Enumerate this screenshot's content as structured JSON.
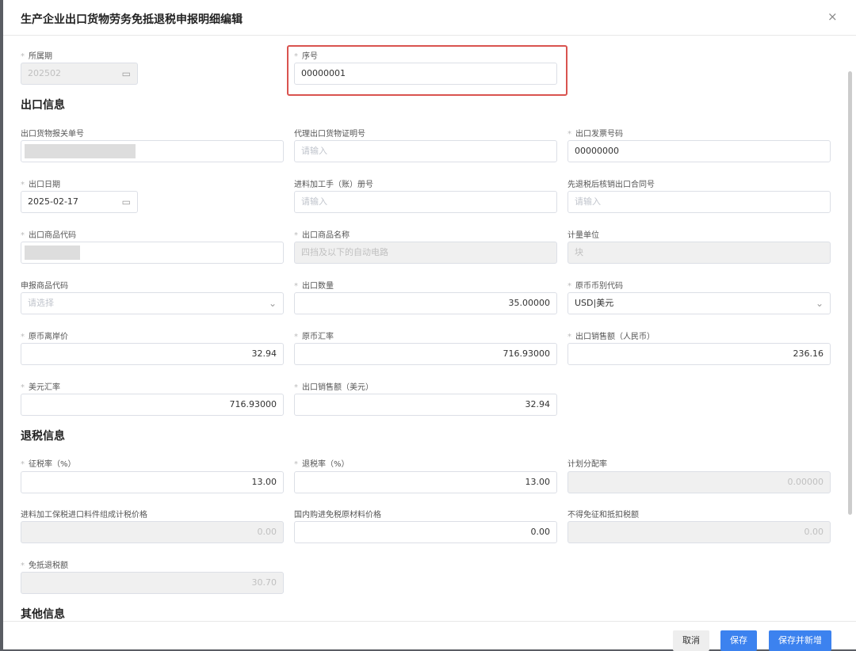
{
  "title": "生产企业出口货物劳务免抵退税申报明细编辑",
  "close": "×",
  "sections": {
    "export": "出口信息",
    "refund": "退税信息",
    "other": "其他信息"
  },
  "placeholder_input": "请输入",
  "placeholder_select": "请选择",
  "fields": {
    "period": {
      "label": "所属期",
      "value": "202502"
    },
    "seq": {
      "label": "序号",
      "value": "00000001"
    },
    "customs_no": {
      "label": "出口货物报关单号"
    },
    "agent_cert": {
      "label": "代理出口货物证明号"
    },
    "invoice_no": {
      "label": "出口发票号码",
      "value": "00000000"
    },
    "export_date": {
      "label": "出口日期",
      "value": "2025-02-17"
    },
    "processing_book": {
      "label": "进料加工手（账）册号"
    },
    "contract_no": {
      "label": "先退税后核销出口合同号"
    },
    "goods_code": {
      "label": "出口商品代码"
    },
    "goods_name": {
      "label": "出口商品名称",
      "value": "四挡及以下的自动电路"
    },
    "unit": {
      "label": "计量单位",
      "value": "块"
    },
    "declared_code": {
      "label": "申报商品代码"
    },
    "quantity": {
      "label": "出口数量",
      "value": "35.00000"
    },
    "currency": {
      "label": "原币币别代码",
      "value": "USD|美元"
    },
    "fob_price": {
      "label": "原币离岸价",
      "value": "32.94"
    },
    "fx_rate": {
      "label": "原币汇率",
      "value": "716.93000"
    },
    "sales_cny": {
      "label": "出口销售额（人民币）",
      "value": "236.16"
    },
    "usd_rate": {
      "label": "美元汇率",
      "value": "716.93000"
    },
    "sales_usd": {
      "label": "出口销售额（美元）",
      "value": "32.94"
    },
    "levy_rate": {
      "label": "征税率（%）",
      "value": "13.00"
    },
    "refund_rate": {
      "label": "退税率（%）",
      "value": "13.00"
    },
    "plan_ratio": {
      "label": "计划分配率",
      "value": "0.00000"
    },
    "bonded_price": {
      "label": "进料加工保税进口料件组成计税价格",
      "value": "0.00"
    },
    "domestic_price": {
      "label": "国内购进免税原材料价格",
      "value": "0.00"
    },
    "non_deductible": {
      "label": "不得免征和抵扣税额",
      "value": "0.00"
    },
    "refund_amount": {
      "label": "免抵退税额",
      "value": "30.70"
    }
  },
  "buttons": {
    "cancel": "取消",
    "save": "保存",
    "save_new": "保存并新增"
  }
}
